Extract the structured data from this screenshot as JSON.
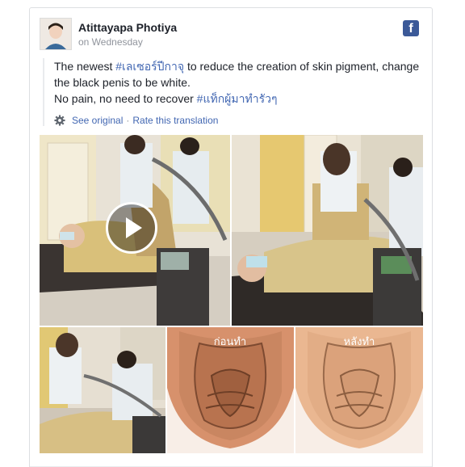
{
  "post": {
    "author": "Atittayapa Photiya",
    "time": "on Wednesday",
    "platform_icon": "facebook-icon",
    "text": {
      "line1_prefix": "The newest ",
      "hashtag1": "#เลเซอร์ปีกาจุ",
      "line1_suffix": " to reduce the creation of skin pigment, change",
      "line2": "the black penis to be white.",
      "line3_prefix": "No pain, no need to recover ",
      "hashtag2": "#แท็กผู้มาทำรัวๆ"
    },
    "translation": {
      "see_original": "See original",
      "separator": "·",
      "rate": "Rate this translation"
    }
  },
  "media": {
    "photos": [
      {
        "name": "clinic-photo-1",
        "has_play_button": true
      },
      {
        "name": "clinic-photo-2"
      },
      {
        "name": "clinic-photo-3"
      },
      {
        "name": "illustration-before",
        "caption": "ก่อนทำ"
      },
      {
        "name": "illustration-after",
        "caption": "หลังทำ"
      }
    ]
  },
  "colors": {
    "link": "#4267b2",
    "secondary_text": "#90949c",
    "facebook_blue": "#3b5998"
  }
}
